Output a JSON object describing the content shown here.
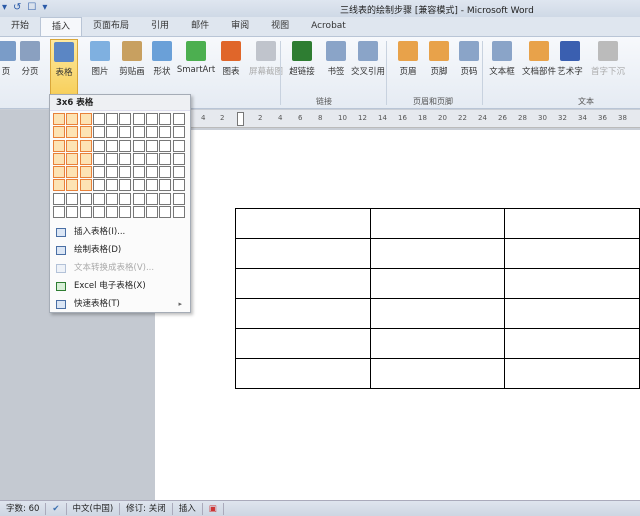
{
  "window": {
    "title": "三线表的绘制步骤 [兼容模式] - Microsoft Word",
    "qat": [
      "▾",
      "↺",
      "☐",
      "▾"
    ]
  },
  "tabs": [
    "开始",
    "插入",
    "页面布局",
    "引用",
    "邮件",
    "审阅",
    "视图",
    "Acrobat"
  ],
  "active_tab": "插入",
  "ribbon": {
    "buttons": [
      {
        "label": "页",
        "icon": "page-icon",
        "color": "#7a9cc8"
      },
      {
        "label": "分页",
        "icon": "page-break-icon",
        "color": "#8aa0c0"
      },
      {
        "label": "表格",
        "icon": "table-icon",
        "color": "#5b86c4"
      },
      {
        "label": "图片",
        "icon": "picture-icon",
        "color": "#7fb0e0"
      },
      {
        "label": "剪贴画",
        "icon": "clipart-icon",
        "color": "#c8a060"
      },
      {
        "label": "形状",
        "icon": "shapes-icon",
        "color": "#6aa0d8"
      },
      {
        "label": "SmartArt",
        "icon": "smartart-icon",
        "color": "#4caf50"
      },
      {
        "label": "图表",
        "icon": "chart-icon",
        "color": "#e0662a"
      },
      {
        "label": "屏幕截图",
        "icon": "screenshot-icon",
        "color": "#c0c4cc"
      },
      {
        "label": "超链接",
        "icon": "hyperlink-icon",
        "color": "#2e7d32"
      },
      {
        "label": "书签",
        "icon": "bookmark-icon",
        "color": "#8aa4c8"
      },
      {
        "label": "交叉引用",
        "icon": "cross-reference-icon",
        "color": "#8aa4c8"
      },
      {
        "label": "页眉",
        "icon": "header-icon",
        "color": "#e8a24a"
      },
      {
        "label": "页脚",
        "icon": "footer-icon",
        "color": "#e8a24a"
      },
      {
        "label": "页码",
        "icon": "page-number-icon",
        "color": "#8aa4c8"
      },
      {
        "label": "文本框",
        "icon": "textbox-icon",
        "color": "#8aa4c8"
      },
      {
        "label": "文档部件",
        "icon": "quick-parts-icon",
        "color": "#e8a24a"
      },
      {
        "label": "艺术字",
        "icon": "wordart-icon",
        "color": "#3a5fb0"
      },
      {
        "label": "首字下沉",
        "icon": "drop-cap-icon",
        "color": "#bbbbbb"
      }
    ],
    "groups": [
      "链接",
      "页眉和页脚",
      "文本"
    ]
  },
  "table_menu": {
    "header": "3x6 表格",
    "grid_cols": 10,
    "grid_rows": 8,
    "selected_cols": 3,
    "selected_rows": 6,
    "items": [
      {
        "label": "插入表格(I)...",
        "disabled": false,
        "submenu": false
      },
      {
        "label": "绘制表格(D)",
        "disabled": false,
        "submenu": false
      },
      {
        "label": "文本转换成表格(V)...",
        "disabled": true,
        "submenu": false
      },
      {
        "label": "Excel 电子表格(X)",
        "disabled": false,
        "submenu": false
      },
      {
        "label": "快速表格(T)",
        "disabled": false,
        "submenu": true
      }
    ],
    "submenu_arrow": "▸"
  },
  "ruler": [
    "4",
    "2",
    "2",
    "4",
    "6",
    "8",
    "10",
    "12",
    "14",
    "16",
    "18",
    "20",
    "22",
    "24",
    "26",
    "28",
    "30",
    "32",
    "34",
    "36",
    "38"
  ],
  "document_table": {
    "rows": 6,
    "cols": 3
  },
  "status": {
    "word_count": "字数: 60",
    "language": "中文(中国)",
    "track_changes": "修订: 关闭",
    "mode": "插入"
  }
}
